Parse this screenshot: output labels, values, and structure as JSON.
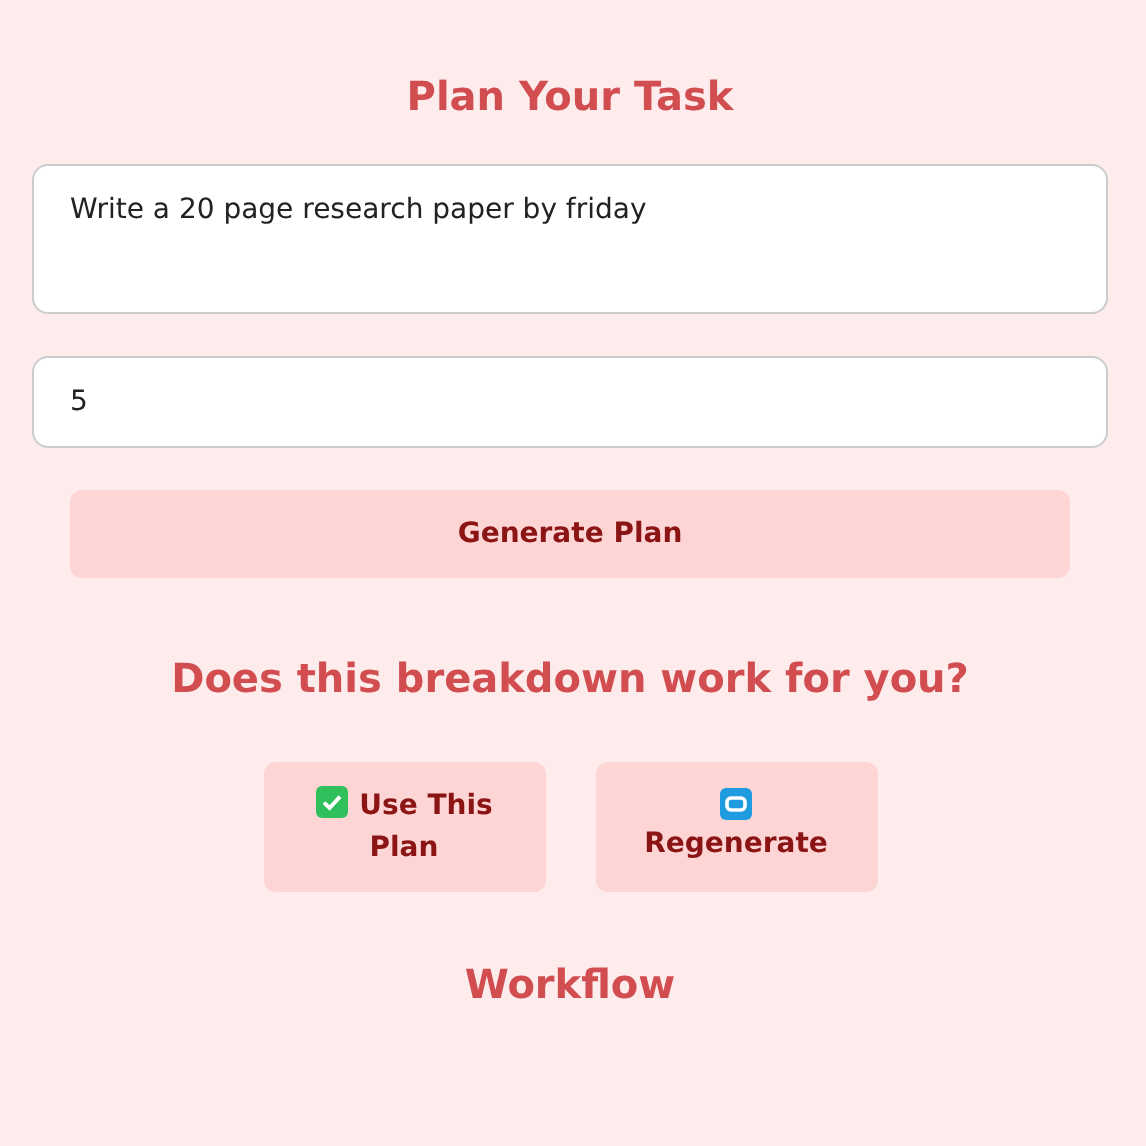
{
  "title": "Plan Your Task",
  "task": {
    "value": "Write a 20 page research paper by friday"
  },
  "count": {
    "value": "5"
  },
  "generate_button": "Generate Plan",
  "question": "Does this breakdown work for you?",
  "actions": [
    {
      "kind": "accept",
      "label": "Use This Plan"
    },
    {
      "kind": "regenerate",
      "label": "Regenerate"
    }
  ],
  "section_title": "Workflow"
}
